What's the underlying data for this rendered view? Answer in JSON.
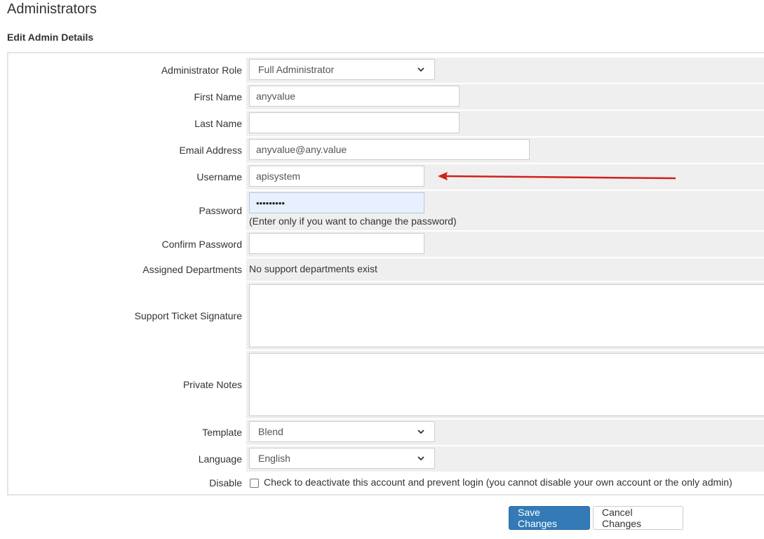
{
  "page": {
    "title": "Administrators",
    "section_title": "Edit Admin Details"
  },
  "form": {
    "admin_role": {
      "label": "Administrator Role",
      "value": "Full Administrator"
    },
    "first_name": {
      "label": "First Name",
      "value": "anyvalue"
    },
    "last_name": {
      "label": "Last Name",
      "value": ""
    },
    "email": {
      "label": "Email Address",
      "value": "anyvalue@any.value"
    },
    "username": {
      "label": "Username",
      "value": "apisystem"
    },
    "password": {
      "label": "Password",
      "value": "•••••••••",
      "help": "(Enter only if you want to change the password)"
    },
    "confirm_password": {
      "label": "Confirm Password",
      "value": ""
    },
    "departments": {
      "label": "Assigned Departments",
      "value": "No support departments exist"
    },
    "signature": {
      "label": "Support Ticket Signature",
      "value": ""
    },
    "notes": {
      "label": "Private Notes",
      "value": ""
    },
    "template": {
      "label": "Template",
      "value": "Blend"
    },
    "language": {
      "label": "Language",
      "value": "English"
    },
    "disable": {
      "label": "Disable",
      "checkbox_text": "Check to deactivate this account and prevent login (you cannot disable your own account or the only admin)",
      "checked": false
    }
  },
  "actions": {
    "save_label": "Save Changes",
    "cancel_label": "Cancel Changes"
  },
  "annotation": {
    "arrow_color": "#d0201b"
  },
  "colors": {
    "primary": "#337ab7",
    "field_bg": "#efefef"
  }
}
